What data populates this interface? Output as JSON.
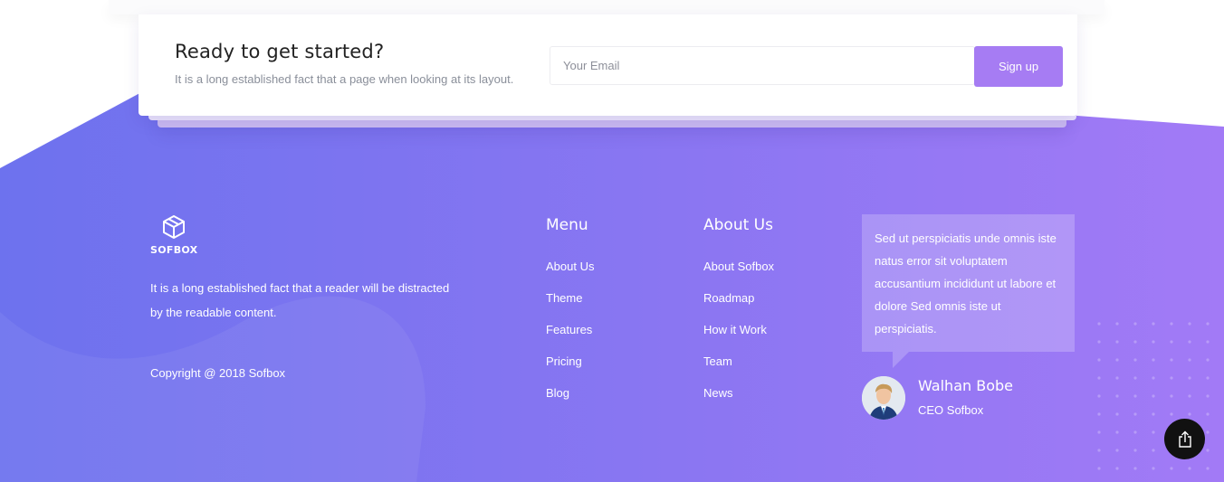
{
  "cta": {
    "title": "Ready to get started?",
    "subtitle": "It is a long established fact that a page when looking at its layout.",
    "email_placeholder": "Your Email",
    "signup_label": "Sign up"
  },
  "brand": {
    "logo_text": "SOFBOX",
    "description": "It is a long established fact that a reader will be distracted by the readable content.",
    "copyright": "Copyright @ 2018 Sofbox"
  },
  "menu": {
    "title": "Menu",
    "items": [
      "About Us",
      "Theme",
      "Features",
      "Pricing",
      "Blog"
    ]
  },
  "about": {
    "title": "About Us",
    "items": [
      "About Sofbox",
      "Roadmap",
      "How it Work",
      "Team",
      "News"
    ]
  },
  "testimonial": {
    "quote": "Sed ut perspiciatis unde omnis iste natus error sit voluptatem accusantium incididunt ut labore et dolore Sed omnis iste ut perspiciatis.",
    "name": "Walhan Bobe",
    "role": "CEO Sofbox"
  },
  "icons": {
    "logo": "cube-logo-icon",
    "share": "share-icon"
  },
  "colors": {
    "gradient_start": "#6c6fee",
    "gradient_end": "#a07af5",
    "button": "#a67cf3",
    "share_button": "#111111"
  }
}
